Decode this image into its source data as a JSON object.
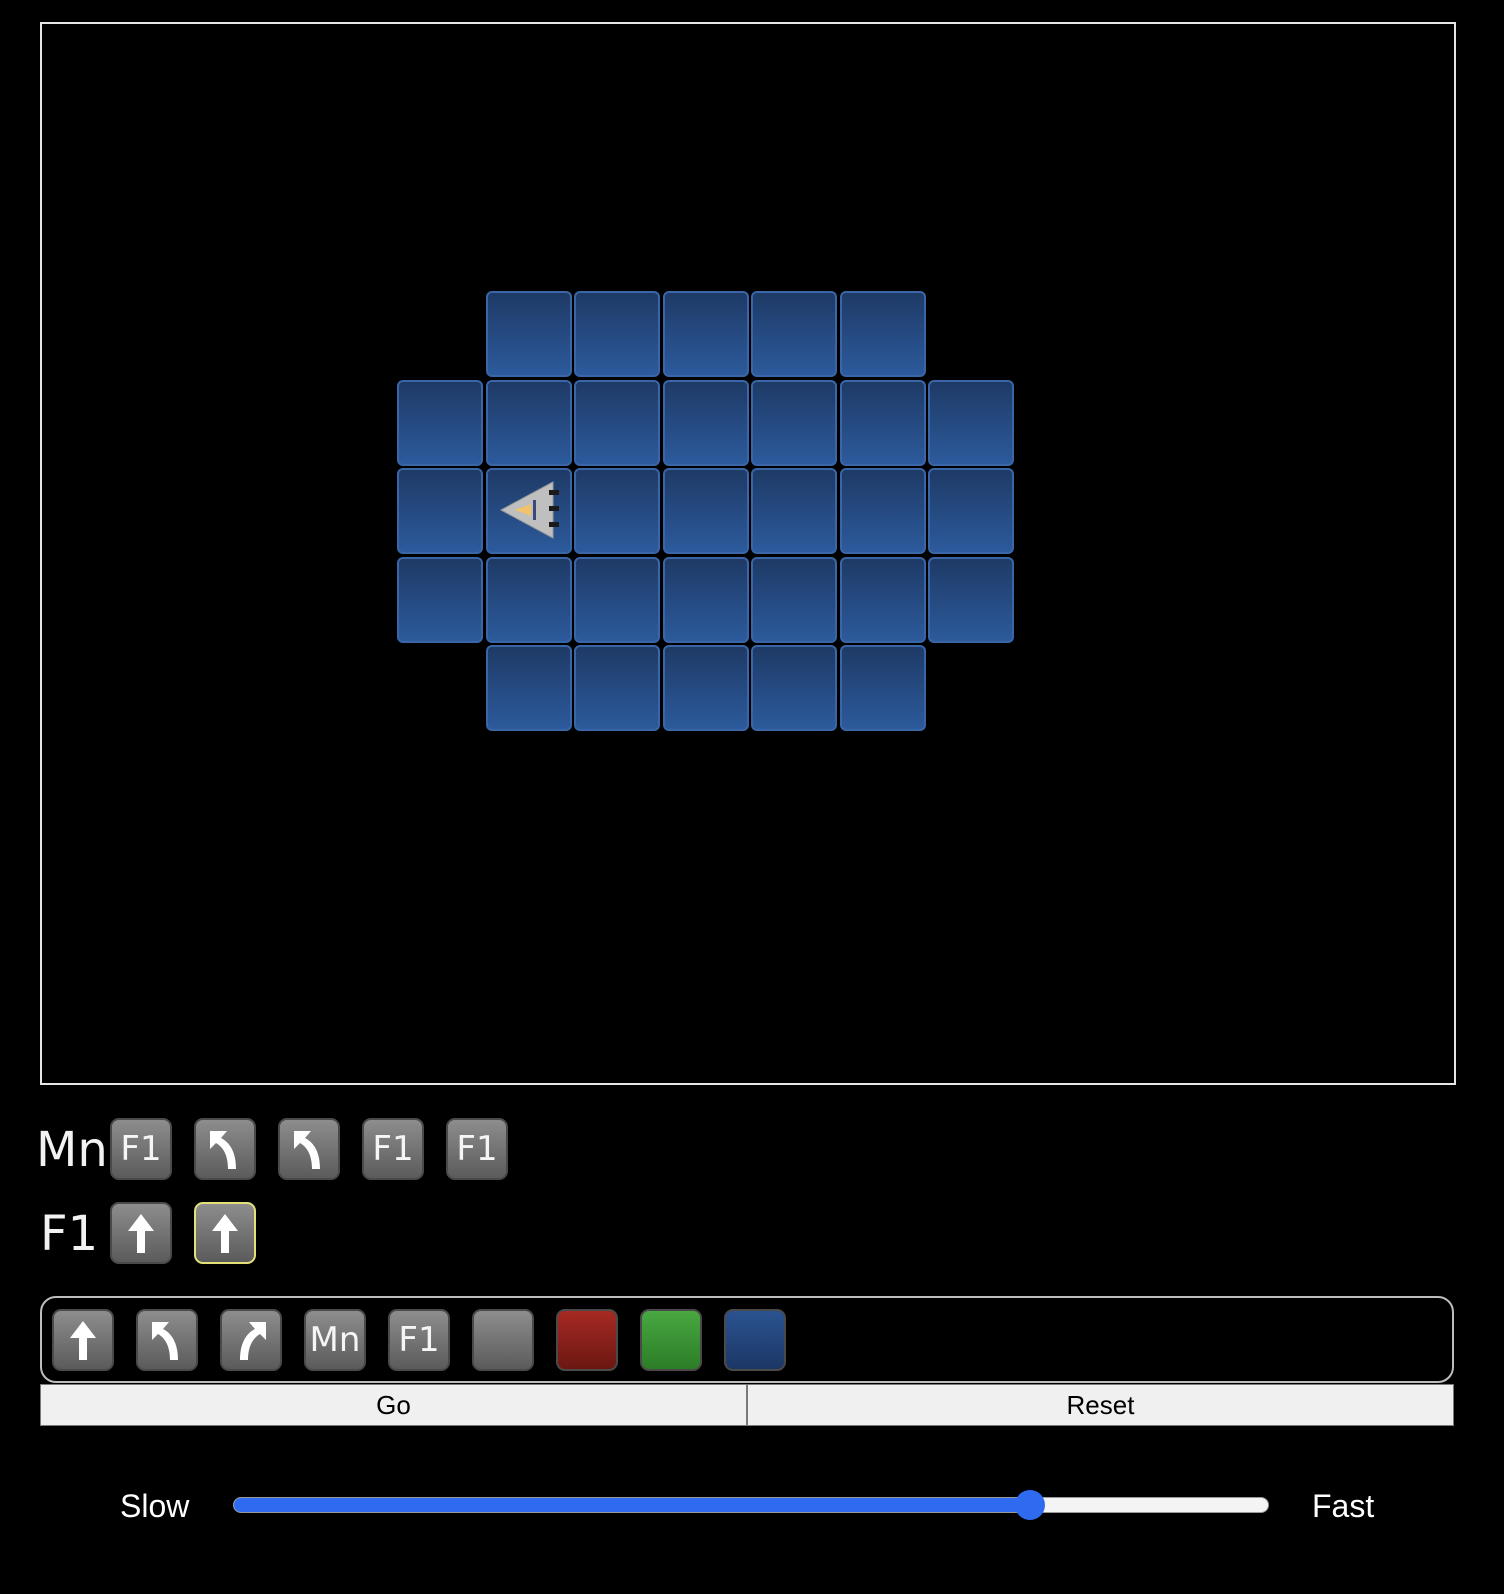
{
  "board": {
    "rows": [
      {
        "cells": [
          false,
          true,
          true,
          true,
          true,
          true,
          false
        ]
      },
      {
        "cells": [
          true,
          true,
          true,
          true,
          true,
          true,
          true
        ]
      },
      {
        "cells": [
          true,
          true,
          true,
          true,
          true,
          true,
          true
        ]
      },
      {
        "cells": [
          true,
          true,
          true,
          true,
          true,
          true,
          true
        ]
      },
      {
        "cells": [
          false,
          true,
          true,
          true,
          true,
          true,
          false
        ]
      }
    ],
    "tile_color": "#2c5a9c",
    "ship": {
      "row": 2,
      "col": 1,
      "facing": "left"
    }
  },
  "programs": [
    {
      "label": "Mn",
      "commands": [
        "call-F1",
        "turn-left",
        "turn-left",
        "call-F1",
        "call-F1"
      ]
    },
    {
      "label": "F1",
      "commands": [
        "forward",
        "forward"
      ],
      "active_index": 1
    }
  ],
  "palette": {
    "items": [
      "forward",
      "turn-left",
      "turn-right",
      "call-Mn",
      "call-F1",
      "color-gray",
      "color-red",
      "color-green",
      "color-blue"
    ]
  },
  "commands_text": {
    "call-F1": "F1",
    "call-Mn": "Mn"
  },
  "controls": {
    "go_label": "Go",
    "reset_label": "Reset"
  },
  "speed": {
    "slow_label": "Slow",
    "fast_label": "Fast",
    "value": 0.77
  }
}
